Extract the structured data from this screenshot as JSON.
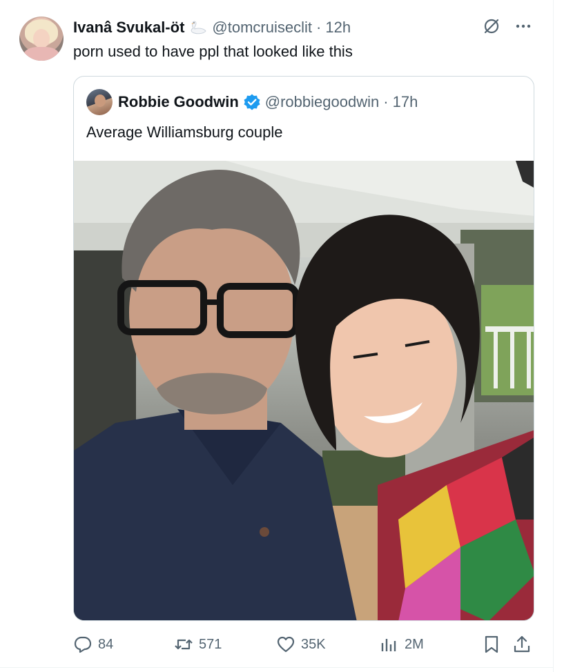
{
  "tweet": {
    "author_name": "Ivanâ Svukal-öt",
    "author_handle": "@tomcruiseclit",
    "time": "· 12h",
    "text": "porn used to have ppl that looked like this"
  },
  "quote": {
    "author_name": "Robbie Goodwin",
    "author_handle": "@robbiegoodwin",
    "time": "· 17h",
    "text": "Average Williamsburg  couple"
  },
  "stats": {
    "replies": "84",
    "retweets": "571",
    "likes": "35K",
    "views": "2M"
  },
  "icons": {
    "reply": "reply-icon",
    "retweet": "retweet-icon",
    "like": "heart-icon",
    "views": "views-icon",
    "bookmark": "bookmark-icon",
    "share": "share-icon",
    "grok": "grok-icon",
    "more": "more-icon",
    "verified": "verified-icon",
    "swan": "swan-emoji-icon"
  },
  "colors": {
    "text_primary": "#0f1419",
    "text_secondary": "#536471",
    "verified_blue": "#1d9bf0",
    "border": "#cfd9de"
  }
}
